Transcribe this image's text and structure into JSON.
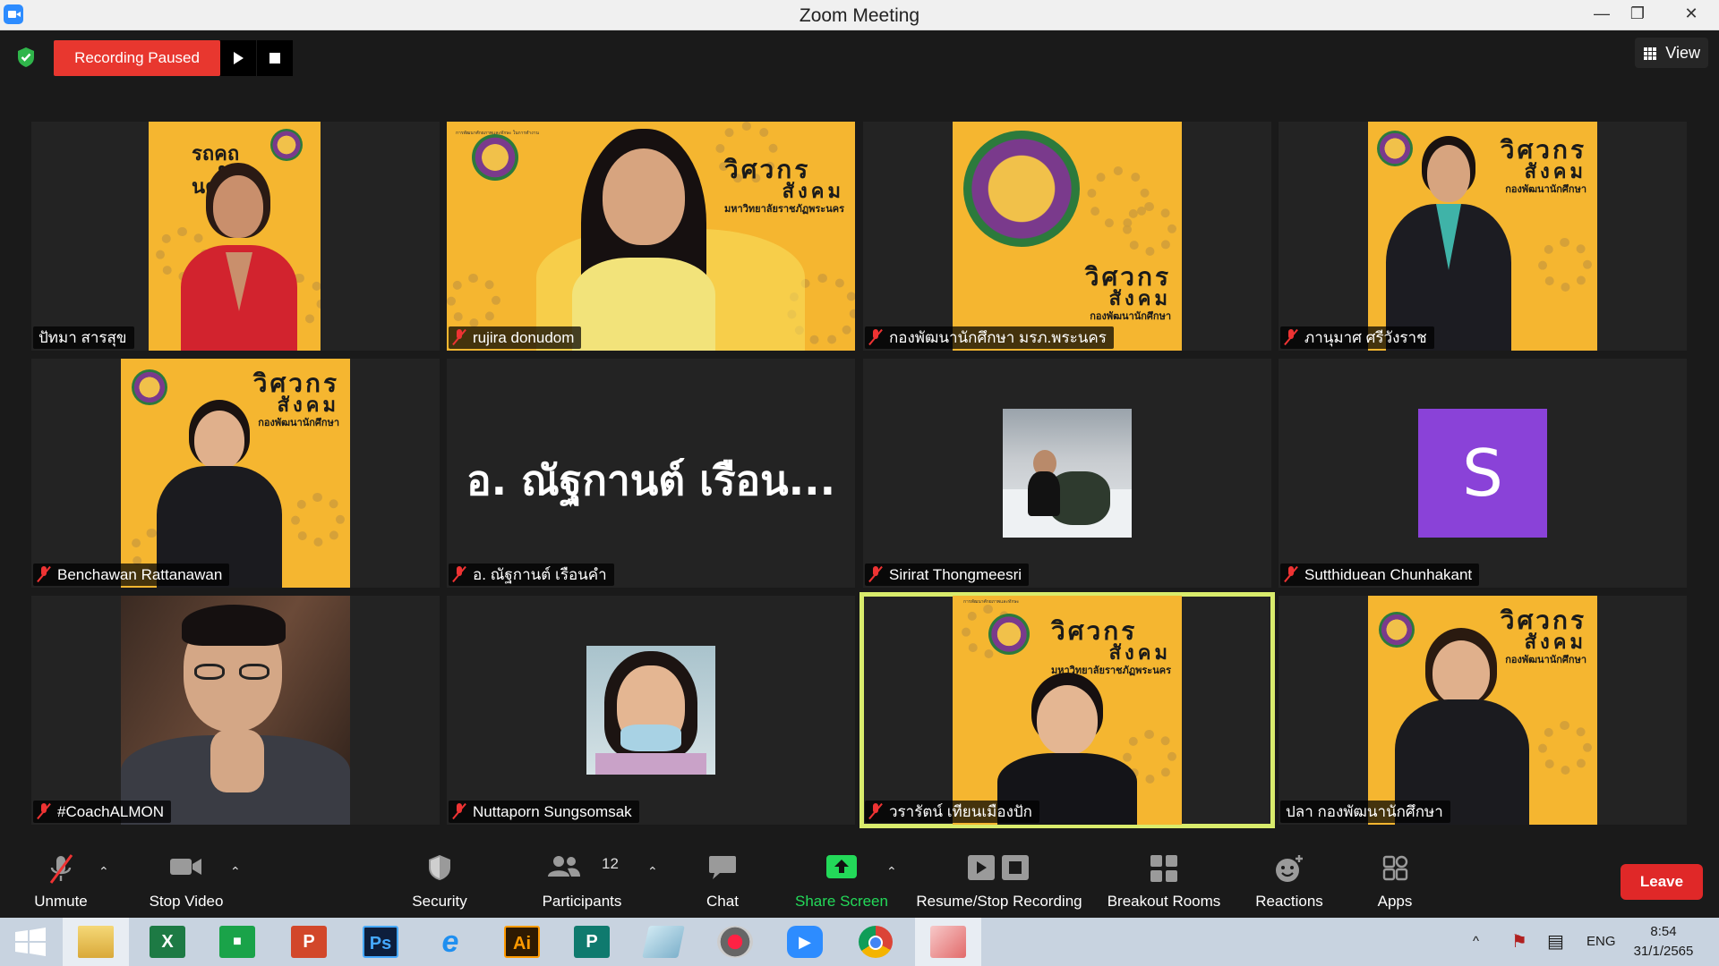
{
  "window": {
    "title": "Zoom Meeting",
    "minimize": "—",
    "maximize": "❐",
    "close": "✕"
  },
  "recording": {
    "status": "Recording Paused"
  },
  "view": {
    "label": "View"
  },
  "participants": [
    {
      "name": "ปัทมา สารสุข",
      "muted": false
    },
    {
      "name": "rujira donudom",
      "muted": true
    },
    {
      "name": "กองพัฒนานักศึกษา มรภ.พระนคร",
      "muted": true
    },
    {
      "name": "ภานุมาศ ศรีวังราช",
      "muted": true
    },
    {
      "name": "Benchawan Rattanawan",
      "muted": true
    },
    {
      "name": "อ. ณัฐกานต์ เรือนคำ",
      "muted": true,
      "display": "อ. ณัฐกานต์ เรือน..."
    },
    {
      "name": "Sirirat Thongmeesri",
      "muted": true
    },
    {
      "name": "Sutthiduean Chunhakant",
      "muted": true,
      "avatar": "S"
    },
    {
      "name": "#CoachALMON",
      "muted": true
    },
    {
      "name": "Nuttaporn Sungsomsak",
      "muted": true
    },
    {
      "name": "วรารัตน์ เทียนเมืองปัก",
      "muted": true,
      "active_speaker": true
    },
    {
      "name": "ปลา กองพัฒนานักศึกษา",
      "muted": false
    }
  ],
  "poster": {
    "line1": "วิศวกร",
    "line2": "สังคม",
    "line3": "กองพัฒนานักศึกษา",
    "line4": "มหาวิทยาลัยราชภัฏพระนคร"
  },
  "toolbar": {
    "unmute": "Unmute",
    "stop_video": "Stop Video",
    "security": "Security",
    "participants": "Participants",
    "participant_count": "12",
    "chat": "Chat",
    "share_screen": "Share Screen",
    "resume_stop_recording": "Resume/Stop Recording",
    "breakout_rooms": "Breakout Rooms",
    "reactions": "Reactions",
    "apps": "Apps",
    "leave": "Leave"
  },
  "taskbar": {
    "apps": [
      "start",
      "file-explorer",
      "excel",
      "store",
      "powerpoint",
      "photoshop",
      "internet-explorer",
      "illustrator",
      "publisher",
      "notes",
      "photoscape",
      "zoom",
      "chrome",
      "paint"
    ],
    "tray_chevron": "^",
    "language": "ENG",
    "time": "8:54",
    "date": "31/1/2565"
  },
  "colors": {
    "recording_red": "#e8372f",
    "share_green": "#23d959",
    "leave_red": "#e02828",
    "active_speaker": "#d9ec6c",
    "poster_yellow": "#f5b630",
    "avatar_purple": "#8a42d8"
  }
}
